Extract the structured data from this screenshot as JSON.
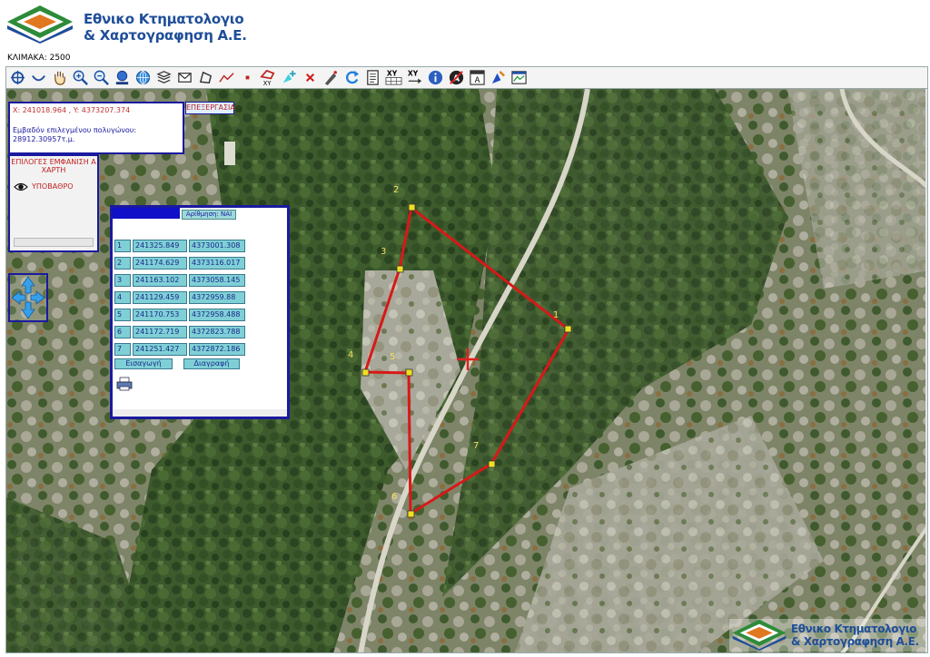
{
  "brand": {
    "line1": "Εθνικο Κτηματολογιο",
    "line2": "& Χαρτογραφηση Α.Ε.",
    "colors": {
      "blue": "#1f4e98",
      "green": "#2e8b3a",
      "orange": "#e07820"
    }
  },
  "scale": {
    "label": "ΚΛΙΜΑΚΑ:",
    "value": "2500"
  },
  "toolbar": {
    "tools": [
      "zoom-extent-icon",
      "lasso-icon",
      "pan-hand-icon",
      "zoom-in-icon",
      "zoom-out-icon",
      "zoom-previous-icon",
      "globe-icon",
      "layers-stack-icon",
      "envelope-select-icon",
      "polygon-icon",
      "polyline-icon",
      "point-icon",
      "polygon-xy-icon",
      "vertex-add-icon",
      "delete-x-icon",
      "edit-vertex-icon",
      "refresh-icon",
      "document-list-icon",
      "xy-table-icon",
      "xy-goto-icon",
      "info-icon",
      "measure-icon",
      "label-a-icon",
      "locate-icon",
      "map-window-icon"
    ],
    "xy_text": "XY"
  },
  "coords": {
    "position": "X: 241018.964 , Y: 4373207.374",
    "area_label": "Εμβαδόν επιλεγμένου πολυγώνου:",
    "area_value": "28912.30957τ.μ."
  },
  "edit_label": "ΕΠΕΞΕΡΓΑΣΙΑ",
  "layers": {
    "title": "ΕΠΙΛΟΓΕΣ ΕΜΦΑΝΙΣΗ Α ΧΑΡΤΗ",
    "base_label": "ΥΠΟΒΑΘΡΟ"
  },
  "points_panel": {
    "numbering_label": "Αρίθμηση: ΝΑΙ",
    "rows": [
      {
        "idx": "1",
        "x": "241325.849",
        "y": "4373001.308"
      },
      {
        "idx": "2",
        "x": "241174.629",
        "y": "4373116.017"
      },
      {
        "idx": "3",
        "x": "241163.102",
        "y": "4373058.145"
      },
      {
        "idx": "4",
        "x": "241129.459",
        "y": "4372959.88"
      },
      {
        "idx": "5",
        "x": "241170.753",
        "y": "4372958.488"
      },
      {
        "idx": "6",
        "x": "241172.719",
        "y": "4372823.788"
      },
      {
        "idx": "7",
        "x": "241251.427",
        "y": "4372872.186"
      }
    ],
    "insert_label": "Εισαγωγή",
    "delete_label": "Διαγραφή"
  },
  "map": {
    "vertex_labels": [
      "1",
      "2",
      "3",
      "4",
      "5",
      "6",
      "7"
    ],
    "polygon_color": "#d81818",
    "vertex_color": "#f0e020",
    "label_color": "#f0e060"
  }
}
